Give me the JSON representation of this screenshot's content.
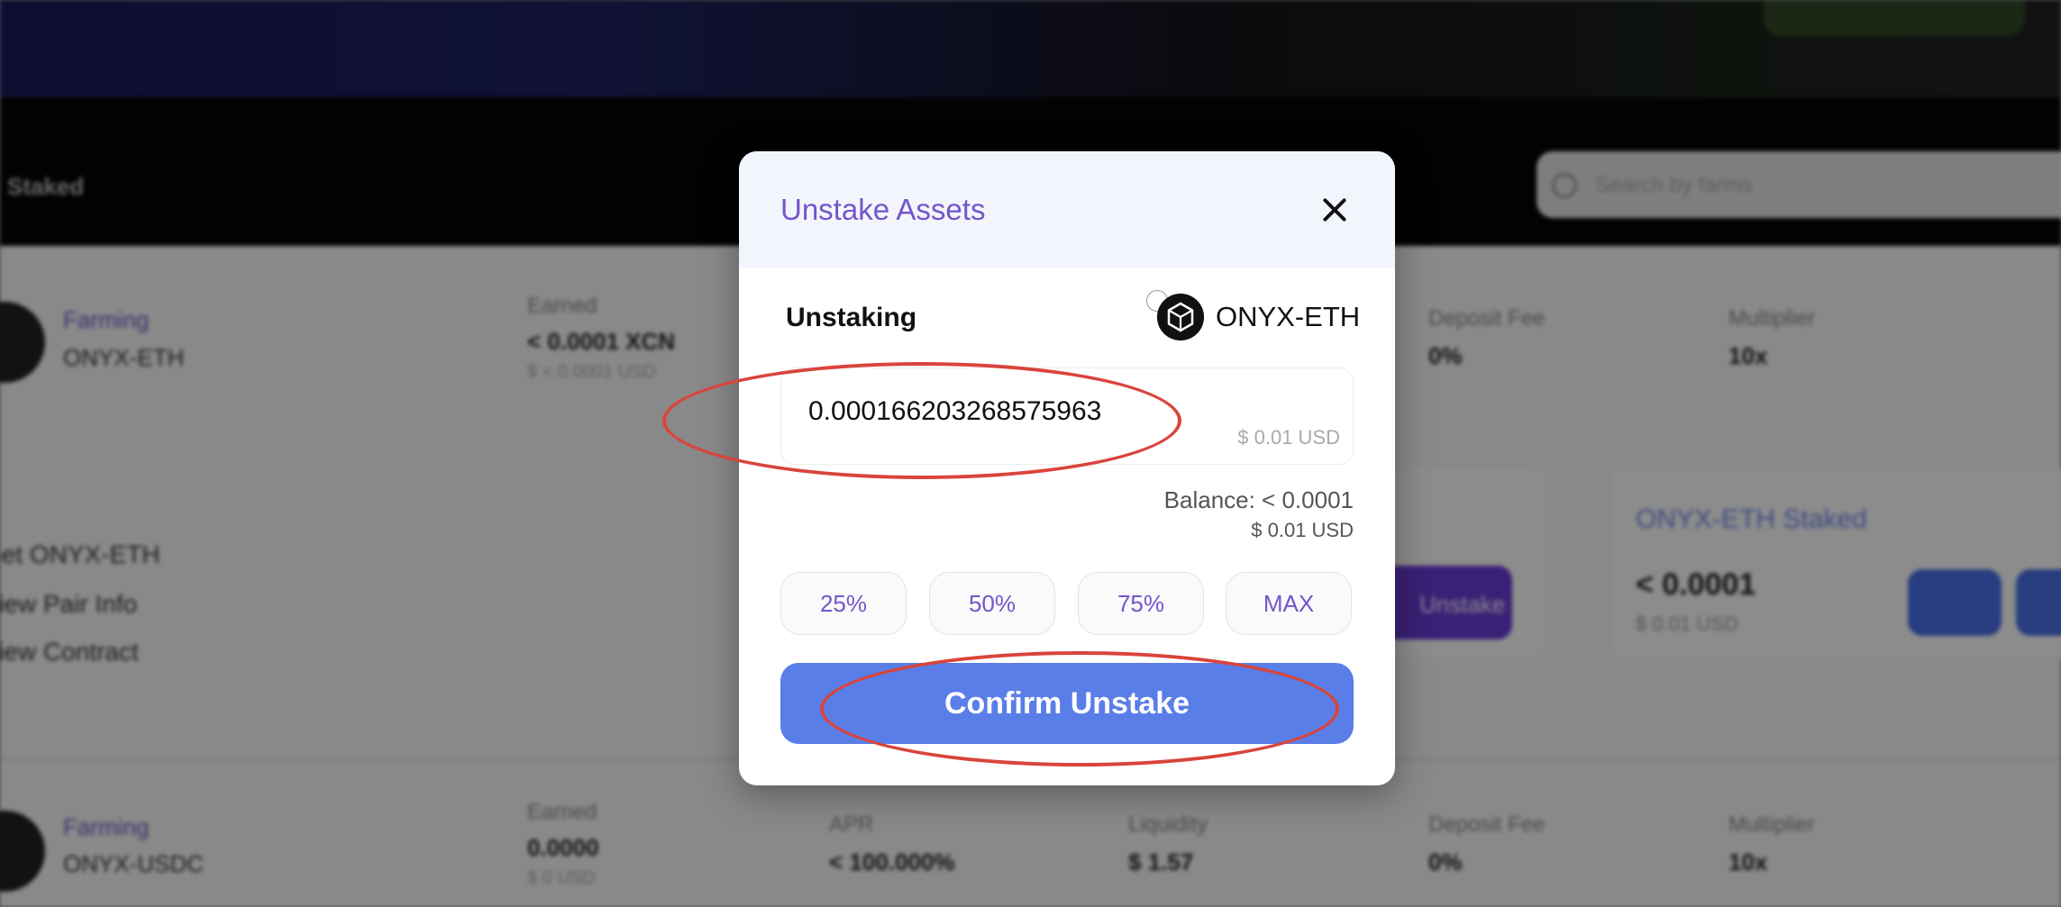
{
  "background": {
    "nav_tab": "Staked",
    "search_placeholder": "Search by farms",
    "row1": {
      "label": "Farming",
      "pair": "ONYX-ETH",
      "earned_label": "Earned",
      "earned_value": "< 0.0001 XCN",
      "earned_sub": "$ < 0.0001 USD",
      "deposit_fee_label": "Deposit Fee",
      "deposit_fee_value": "0%",
      "multiplier_label": "Multiplier",
      "multiplier_value": "10x"
    },
    "links": [
      "Get ONYX-ETH",
      "View Pair Info",
      "View Contract"
    ],
    "staked_card": {
      "title": "ONYX-ETH Staked",
      "value": "< 0.0001",
      "sub": "$ 0.01 USD"
    },
    "unstake_btn": "Unstake",
    "row2": {
      "label": "Farming",
      "pair": "ONYX-USDC",
      "earned_label": "Earned",
      "earned_value": "0.0000",
      "earned_sub": "$ 0 USD",
      "apr_label": "APR",
      "apr_value": "< 100.000%",
      "liquidity_label": "Liquidity",
      "liquidity_value": "$ 1.57",
      "deposit_fee_label": "Deposit Fee",
      "deposit_fee_value": "0%",
      "multiplier_label": "Multiplier",
      "multiplier_value": "10x"
    }
  },
  "modal": {
    "title": "Unstake Assets",
    "section_label": "Unstaking",
    "token_name": "ONYX-ETH",
    "amount_value": "0.000166203268575963",
    "amount_usd": "$ 0.01 USD",
    "balance": "Balance: < 0.0001",
    "balance_usd": "$ 0.01 USD",
    "percent_buttons": [
      "25%",
      "50%",
      "75%",
      "MAX"
    ],
    "confirm_label": "Confirm Unstake"
  },
  "colors": {
    "accent_purple": "#7355cc",
    "confirm_blue": "#5a7ee8",
    "annotation_red": "#d9443c"
  }
}
